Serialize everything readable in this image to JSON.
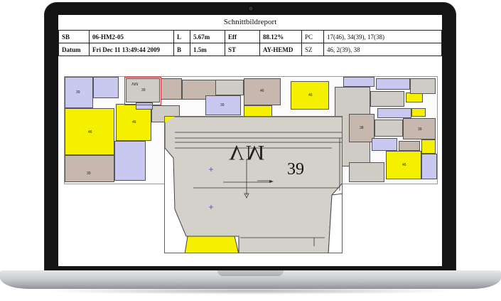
{
  "report": {
    "title": "Schnittbildreport",
    "rows": [
      [
        {
          "label": "SB",
          "value": "06-HM2-05"
        },
        {
          "label": "L",
          "value": "5.67m"
        },
        {
          "label": "Eff",
          "value": "88.12%"
        },
        {
          "label": "PC",
          "value": "17(46), 34(39), 17(38)"
        }
      ],
      [
        {
          "label": "Datum",
          "value": "Fri Dec 11 13:49:44 2009"
        },
        {
          "label": "B",
          "value": "1.5m"
        },
        {
          "label": "ST",
          "value": "AY-HEMD"
        },
        {
          "label": "SZ",
          "value": "46, 2(39), 38"
        }
      ]
    ]
  },
  "marker": {
    "piece_sizes": [
      "39",
      "46",
      "39",
      "46",
      "39",
      "46",
      "38",
      "46",
      "39",
      "38",
      "39",
      "46",
      "39"
    ],
    "mirror_text": "VM"
  },
  "zoom": {
    "mirror_text": "VM",
    "size_label": "39"
  },
  "colors": {
    "yellow_piece": "#f4f000",
    "lavender_piece": "#c9c8f0",
    "gray_piece": "#cfccc6",
    "brown_piece": "#c6b8ae",
    "highlight": "#e0292b"
  }
}
